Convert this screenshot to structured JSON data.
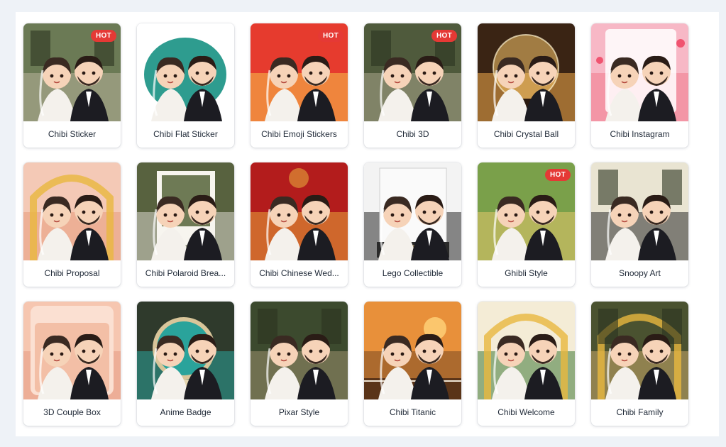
{
  "badge_text": "HOT",
  "colors": {
    "page_background": "#eef2f7",
    "card_background": "#ffffff",
    "badge": "#e53935"
  },
  "styles": [
    {
      "label": "Chibi Sticker",
      "hot": true,
      "bg": "#6b7a55",
      "bg2": "#b8b39a",
      "theme": "garden"
    },
    {
      "label": "Chibi Flat Sticker",
      "hot": false,
      "bg": "#ffffff",
      "bg2": "#2e9c8f",
      "theme": "sticker"
    },
    {
      "label": "Chibi Emoji Stickers",
      "hot": true,
      "bg": "#e63b2e",
      "bg2": "#f6c34a",
      "theme": "emoji"
    },
    {
      "label": "Chibi 3D",
      "hot": true,
      "bg": "#4f5a3c",
      "bg2": "#a9a58a",
      "theme": "garden"
    },
    {
      "label": "Chibi Crystal Ball",
      "hot": false,
      "bg": "#3a2414",
      "bg2": "#f0a94a",
      "theme": "crystal"
    },
    {
      "label": "Chibi Instagram",
      "hot": false,
      "bg": "#f7b8c6",
      "bg2": "#f07a8c",
      "theme": "insta"
    },
    {
      "label": "Chibi Proposal",
      "hot": false,
      "bg": "#f4c9b6",
      "bg2": "#e89a7c",
      "theme": "proposal"
    },
    {
      "label": "Chibi Polaroid Brea...",
      "hot": false,
      "bg": "#58623f",
      "bg2": "#d9d6cc",
      "theme": "polaroid"
    },
    {
      "label": "Chibi Chinese Wed...",
      "hot": false,
      "bg": "#b31c1c",
      "bg2": "#e5a53a",
      "theme": "chinese"
    },
    {
      "label": "Lego Collectible",
      "hot": false,
      "bg": "#f3f3f3",
      "bg2": "#2a2a2a",
      "theme": "lego"
    },
    {
      "label": "Ghibli Style",
      "hot": true,
      "bg": "#7aa04a",
      "bg2": "#e3c76b",
      "theme": "ghibli"
    },
    {
      "label": "Snoopy Art",
      "hot": false,
      "bg": "#e9e4d2",
      "bg2": "#2b2b2b",
      "theme": "snoopy"
    },
    {
      "label": "3D Couple Box",
      "hot": false,
      "bg": "#f6c6b0",
      "bg2": "#e59a84",
      "theme": "box"
    },
    {
      "label": "Anime Badge",
      "hot": false,
      "bg": "#2f3a2c",
      "bg2": "#2aa39b",
      "theme": "badge"
    },
    {
      "label": "Pixar Style",
      "hot": false,
      "bg": "#3c4a2e",
      "bg2": "#9b8f6e",
      "theme": "garden"
    },
    {
      "label": "Chibi Titanic",
      "hot": false,
      "bg": "#e8903a",
      "bg2": "#7a4a24",
      "theme": "titanic"
    },
    {
      "label": "Chibi Welcome",
      "hot": false,
      "bg": "#f4ecd6",
      "bg2": "#3f7a3a",
      "theme": "welcome"
    },
    {
      "label": "Chibi Family",
      "hot": false,
      "bg": "#4a5230",
      "bg2": "#c9a86a",
      "theme": "family"
    }
  ]
}
